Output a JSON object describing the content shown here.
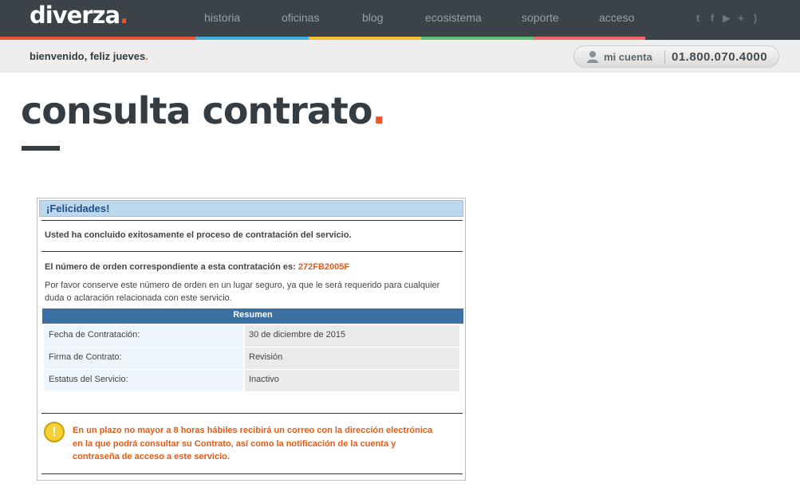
{
  "header": {
    "logo": "diverza",
    "logo_dot": ".",
    "nav": [
      "historia",
      "oficinas",
      "blog",
      "ecosistema",
      "soporte",
      "acceso"
    ],
    "social_icons": [
      "twitter-icon",
      "facebook-icon",
      "play-icon",
      "plus-icon",
      "rss-icon"
    ],
    "strip_colors": [
      "#e8553a",
      "#3fb3df",
      "#f0c030",
      "#5cbf7a",
      "#f0666f",
      "#3b4248"
    ]
  },
  "welcome": {
    "greeting": "bienvenido, feliz jueves",
    "greeting_dot": ".",
    "account_label": "mi cuenta",
    "phone": "01.800.070.4000"
  },
  "page": {
    "title": "consulta contrato",
    "title_dot": "."
  },
  "panel": {
    "heading": "¡Felicidades!",
    "success_message": "Usted ha concluido exitosamente el proceso de contratación del servicio.",
    "order_prefix": "El número de orden correspondiente a esta contratación es:",
    "order_number": "272FB2005F",
    "keep_line1": "Por favor conserve este número de orden en un lugar seguro, ya que le será requerido para cualquier",
    "keep_line2": "duda o aclaración relacionada con este servicio.",
    "summary_title": "Resumen",
    "summary_rows": [
      {
        "label": "Fecha de Contratación:",
        "value": "30 de diciembre de 2015"
      },
      {
        "label": "Firma de Contrato:",
        "value": "Revisión"
      },
      {
        "label": "Estatus del Servicio:",
        "value": "Inactivo"
      }
    ],
    "notice_icon": "!",
    "notice_line1": "En un plazo no mayor a 8 horas hábiles recibirá un correo con la dirección electrónica",
    "notice_line2": "en la que podrá consultar su Contrato, así como la notificación de la cuenta y",
    "notice_line3": "contraseña de acceso a este servicio."
  }
}
